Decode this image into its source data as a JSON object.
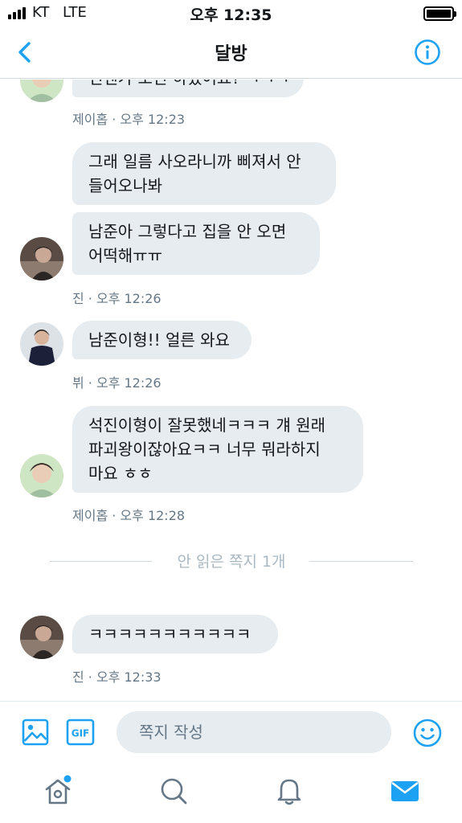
{
  "status_bar": {
    "carrier": "KT",
    "network": "LTE",
    "time": "오후 12:35"
  },
  "header": {
    "title": "달방"
  },
  "messages": {
    "partial_text": "언젠가 오긴 하겠어요? ㅋㅋㅋ",
    "meta_1": "제이홉 · 오후 12:23",
    "bubble_2a": "그래 일름 사오라니까 삐져서 안\n들어오나봐",
    "bubble_2b": "남준아 그렇다고 집을 안 오면\n어떡해ㅠㅠ",
    "meta_2": "진 · 오후 12:26",
    "bubble_3": "남준이형!! 얼른 와요",
    "meta_3": "뷔 · 오후 12:26",
    "bubble_4": "석진이형이 잘못했네ㅋㅋㅋ 걔 원래\n파괴왕이잖아요ㅋㅋ 너무 뭐라하지\n마요 ㅎㅎ",
    "meta_4": "제이홉 · 오후 12:28",
    "unread_divider": "안 읽은 쪽지 1개",
    "bubble_5": "ㅋㅋㅋㅋㅋㅋㅋㅋㅋㅋㅋ",
    "meta_5": "진 · 오후 12:33"
  },
  "composer": {
    "placeholder": "쪽지 작성",
    "gif_label": "GIF"
  },
  "colors": {
    "accent": "#1da1f2",
    "bubble": "#e6ecf0",
    "meta": "#657786",
    "divider": "#cfd6dc"
  },
  "icons": {
    "back": "chevron-left-icon",
    "info": "info-icon",
    "media": "image-icon",
    "gif": "gif-icon",
    "emoji": "emoji-icon",
    "home": "home-icon",
    "search": "search-icon",
    "notifications": "bell-icon",
    "messages": "envelope-icon"
  }
}
